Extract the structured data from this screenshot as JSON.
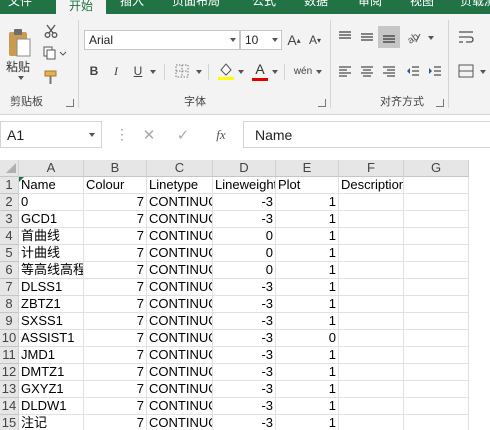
{
  "ribbon_tabs": [
    "文件",
    "开始",
    "插入",
    "页面布局",
    "公式",
    "数据",
    "审阅",
    "视图",
    "负载测"
  ],
  "active_tab_index": 1,
  "clipboard": {
    "paste_label": "粘贴",
    "group_label": "剪贴板"
  },
  "font": {
    "name": "Arial",
    "size": "10",
    "group_label": "字体",
    "bold": "B",
    "italic": "I",
    "underline": "U",
    "font_color": "A",
    "phonetic": "wén"
  },
  "alignment": {
    "group_label": "对齐方式"
  },
  "formula_bar": {
    "name_box": "A1",
    "formula": "Name",
    "fx": "fx"
  },
  "columns": [
    "A",
    "B",
    "C",
    "D",
    "E",
    "F",
    "G"
  ],
  "rows": [
    {
      "num": "1",
      "cells": [
        "Name",
        "Colour",
        "Linetype",
        "Lineweight",
        "Plot",
        "Description"
      ]
    },
    {
      "num": "2",
      "cells": [
        "0",
        "7",
        "CONTINUOUS",
        "-3",
        "1",
        ""
      ]
    },
    {
      "num": "3",
      "cells": [
        "GCD1",
        "7",
        "CONTINUOUS",
        "-3",
        "1",
        ""
      ]
    },
    {
      "num": "4",
      "cells": [
        "首曲线",
        "7",
        "CONTINUOUS",
        "0",
        "1",
        ""
      ]
    },
    {
      "num": "5",
      "cells": [
        "计曲线",
        "7",
        "CONTINUOUS",
        "0",
        "1",
        ""
      ]
    },
    {
      "num": "6",
      "cells": [
        "等高线高程",
        "7",
        "CONTINUOUS",
        "0",
        "1",
        ""
      ]
    },
    {
      "num": "7",
      "cells": [
        "DLSS1",
        "7",
        "CONTINUOUS",
        "-3",
        "1",
        ""
      ]
    },
    {
      "num": "8",
      "cells": [
        "ZBTZ1",
        "7",
        "CONTINUOUS",
        "-3",
        "1",
        ""
      ]
    },
    {
      "num": "9",
      "cells": [
        "SXSS1",
        "7",
        "CONTINUOUS",
        "-3",
        "1",
        ""
      ]
    },
    {
      "num": "10",
      "cells": [
        "ASSIST1",
        "7",
        "CONTINUOUS",
        "-3",
        "0",
        ""
      ]
    },
    {
      "num": "11",
      "cells": [
        "JMD1",
        "7",
        "CONTINUOUS",
        "-3",
        "1",
        ""
      ]
    },
    {
      "num": "12",
      "cells": [
        "DMTZ1",
        "7",
        "CONTINUOUS",
        "-3",
        "1",
        ""
      ]
    },
    {
      "num": "13",
      "cells": [
        "GXYZ1",
        "7",
        "CONTINUOUS",
        "-3",
        "1",
        ""
      ]
    },
    {
      "num": "14",
      "cells": [
        "DLDW1",
        "7",
        "CONTINUOUS",
        "-3",
        "1",
        ""
      ]
    },
    {
      "num": "15",
      "cells": [
        "注记",
        "7",
        "CONTINUOUS",
        "-3",
        "1",
        ""
      ]
    }
  ],
  "colors": {
    "brand": "#217346",
    "ribbon_bg": "#f3f3f3",
    "header_bg": "#e6e6e6"
  }
}
